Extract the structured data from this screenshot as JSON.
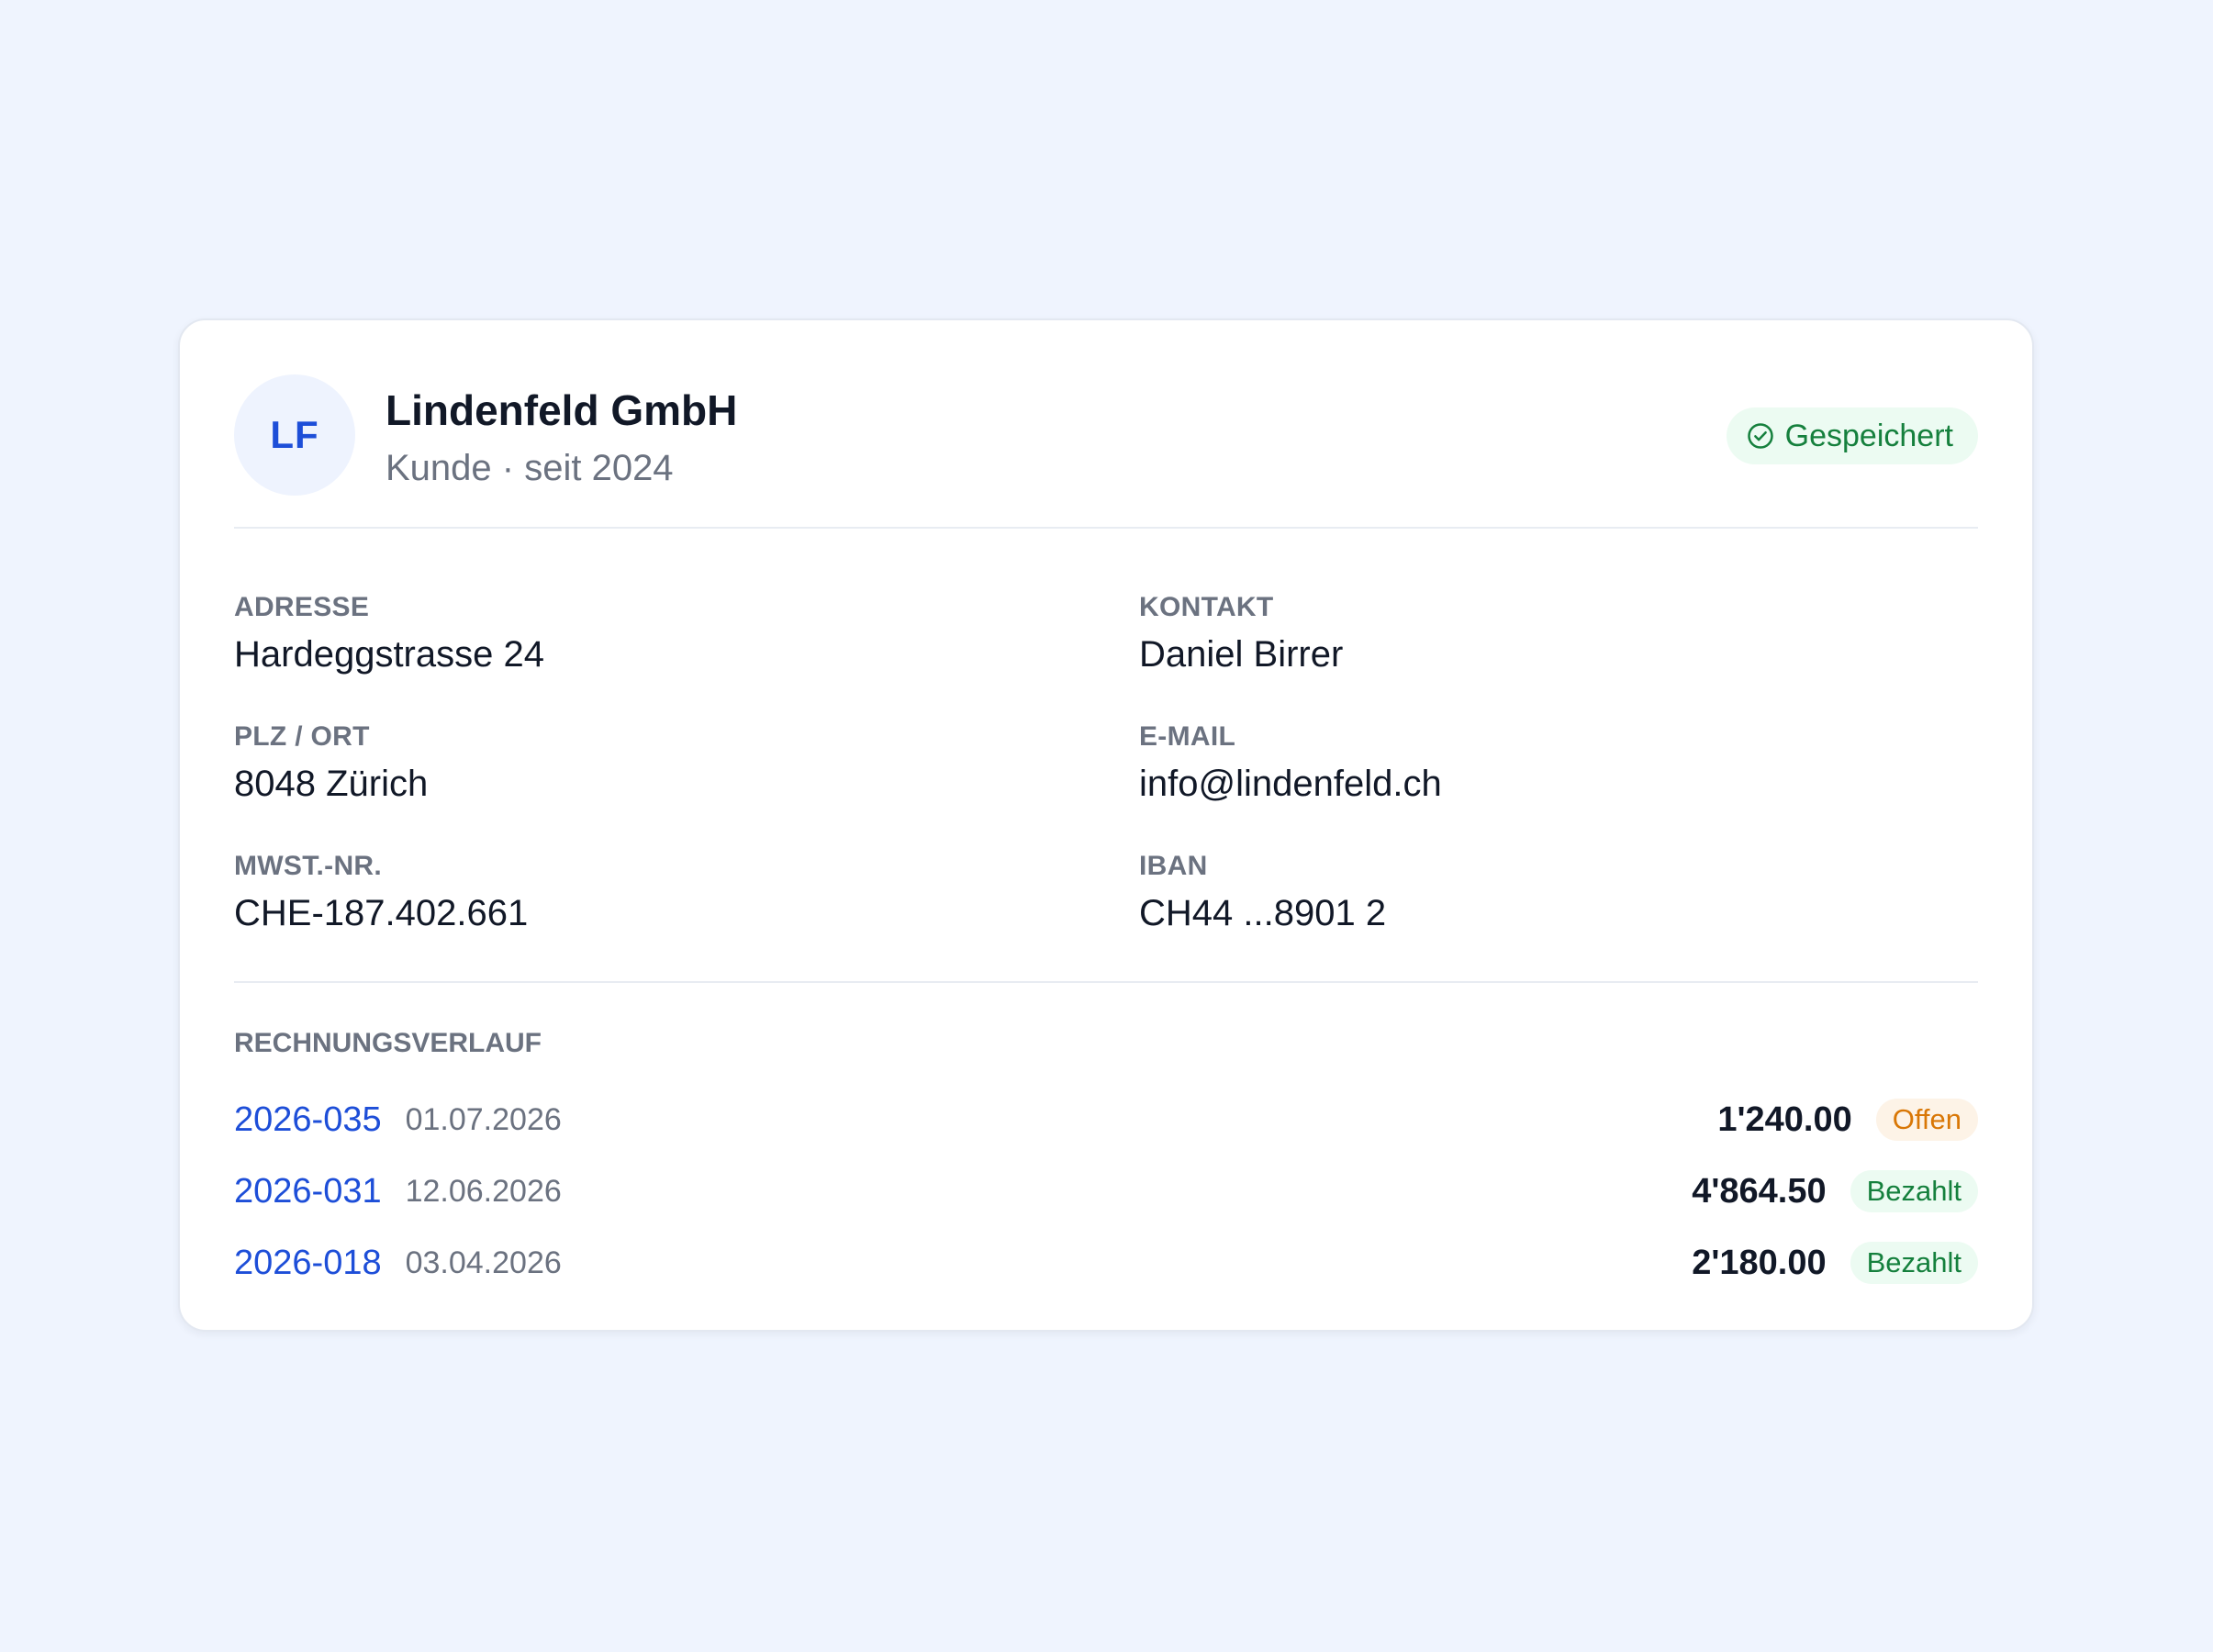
{
  "customer": {
    "initials": "LF",
    "name": "Lindenfeld GmbH",
    "subtitle": "Kunde · seit 2024"
  },
  "save_status": {
    "label": "Gespeichert",
    "icon": "check-circle-icon",
    "color": "#15803d"
  },
  "fields": {
    "address": {
      "label": "ADRESSE",
      "value": "Hardeggstrasse 24"
    },
    "zip_city": {
      "label": "PLZ / ORT",
      "value": "8048 Zürich"
    },
    "vat_number": {
      "label": "MWST.-NR.",
      "value": "CHE-187.402.661"
    },
    "contact": {
      "label": "KONTAKT",
      "value": "Daniel Birrer"
    },
    "email": {
      "label": "E-MAIL",
      "value": "info@lindenfeld.ch"
    },
    "iban": {
      "label": "IBAN",
      "value": "CH44 ...8901 2"
    }
  },
  "invoice_history": {
    "label": "RECHNUNGSVERLAUF",
    "invoices": [
      {
        "number": "2026-035",
        "date": "01.07.2026",
        "amount": "1'240.00",
        "status": "Offen"
      },
      {
        "number": "2026-031",
        "date": "12.06.2026",
        "amount": "4'864.50",
        "status": "Bezahlt"
      },
      {
        "number": "2026-018",
        "date": "03.04.2026",
        "amount": "2'180.00",
        "status": "Bezahlt"
      }
    ]
  },
  "colors": {
    "accent": "#1d4ed8",
    "page_background": "#eff4fe",
    "status_open": "#d97706",
    "status_paid": "#15803d"
  }
}
